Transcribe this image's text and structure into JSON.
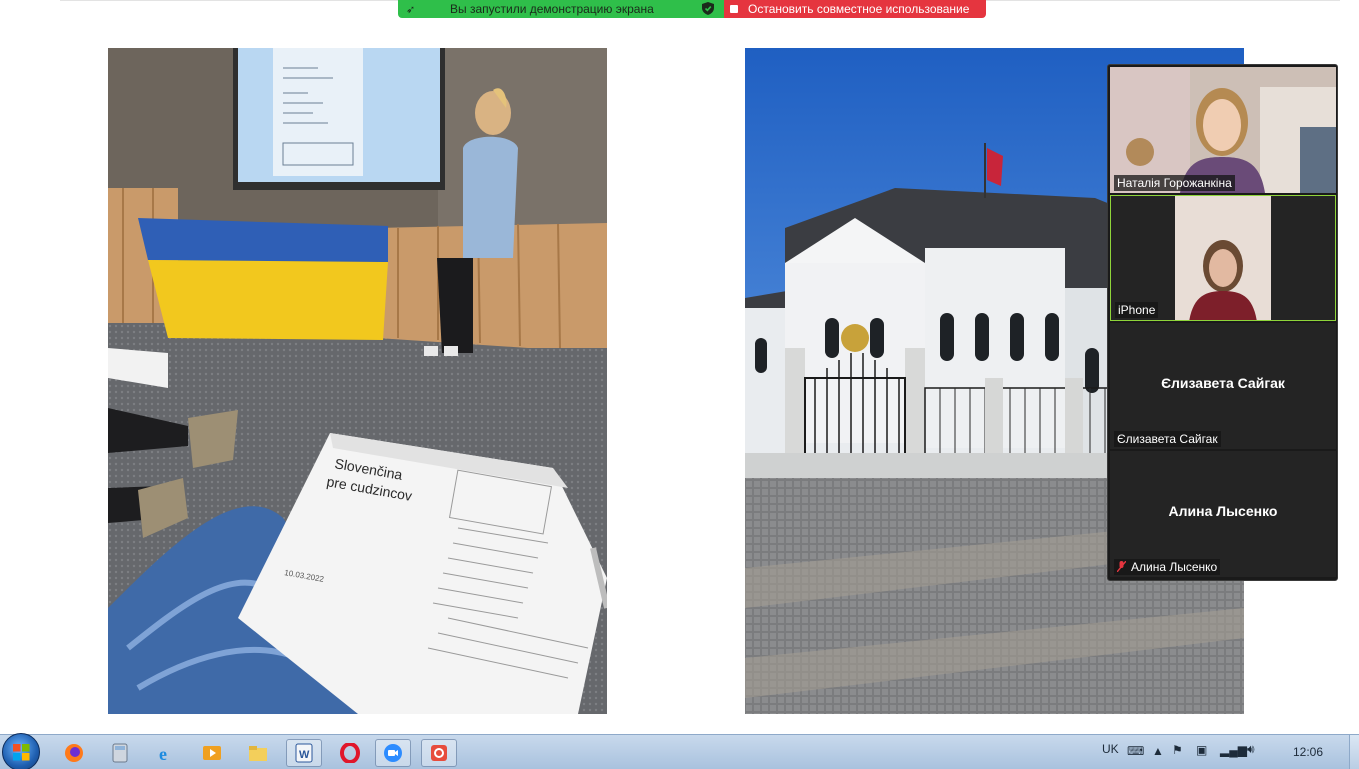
{
  "share_bar": {
    "status_text": "Вы запустили демонстрацию экрана",
    "stop_label": "Остановить совместное использование",
    "status_color": "#2fbf4a",
    "stop_color": "#e5353f"
  },
  "slides": {
    "left_photo": {
      "handout_title": "Slovenčina\npre cudzincov",
      "handout_date": "10.03.2022"
    },
    "right_photo": {}
  },
  "participants": [
    {
      "name": "Наталія Горожанкіна",
      "video": true,
      "active_speaker": false,
      "muted": false
    },
    {
      "name": "iPhone",
      "video": true,
      "active_speaker": true,
      "muted": false
    },
    {
      "name": "Єлизавета Сайгак",
      "display_name": "Єлизавета Сайгак",
      "video": false,
      "muted": false
    },
    {
      "name": "Алина Лысенко",
      "display_name": "Алина Лысенко",
      "video": false,
      "muted": true
    }
  ],
  "taskbar": {
    "apps": [
      "firefox-icon",
      "calculator-icon",
      "internet-explorer-icon",
      "media-player-icon",
      "file-explorer-icon",
      "word-icon",
      "opera-icon",
      "zoom-icon",
      "snipping-tool-icon"
    ],
    "tray": {
      "language": "UK",
      "time": "12:06"
    }
  }
}
